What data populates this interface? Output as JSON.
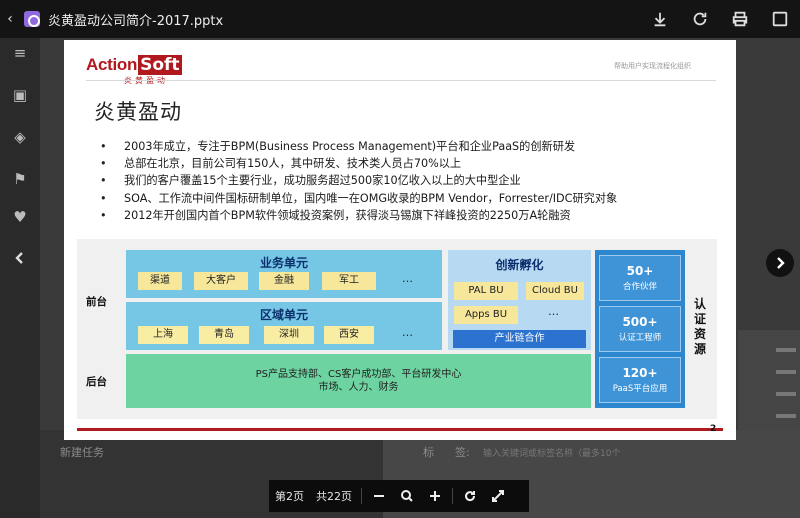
{
  "window": {
    "title": "炎黄盈动公司简介-2017.pptx",
    "back_icon": "back-icon",
    "file_icon": "pptx-file-icon",
    "actions": [
      "download-icon",
      "refresh-icon",
      "print-icon",
      "fullscreen-icon"
    ]
  },
  "background": {
    "new_task": "新建任务",
    "tag_label": "标",
    "tag_label2": "签:",
    "tag_placeholder": "输入关键词或标签名称（最多10个"
  },
  "slide": {
    "logo_action": "Action",
    "logo_soft": "Soft",
    "logo_sub": "炎黄盈动",
    "tagline": "帮助用户实现流程化组织",
    "title": "炎黄盈动",
    "bullets": [
      "2003年成立，专注于BPM(Business Process Management)平台和企业PaaS的创新研发",
      "总部在北京，目前公司有150人，其中研发、技术类人员占70%以上",
      "我们的客户覆盖15个主要行业，成功服务超过500家10亿收入以上的大中型企业",
      "SOA、工作流中间件国标研制单位，国内唯一在OMG收录的BPM Vendor，Forrester/IDC研究对象",
      "2012年开创国内首个BPM软件领域投资案例，获得淡马锡旗下祥峰投资的2250万A轮融资"
    ],
    "page_number": "2",
    "diagram": {
      "front_label": "前台",
      "back_label": "后台",
      "business_unit": {
        "title": "业务单元",
        "items": [
          "渠道",
          "大客户",
          "金融",
          "军工"
        ],
        "more": "…"
      },
      "region_unit": {
        "title": "区域单元",
        "items": [
          "上海",
          "青岛",
          "深圳",
          "西安"
        ],
        "more": "…"
      },
      "incubation": {
        "title": "创新孵化",
        "items": [
          "PAL BU",
          "Cloud BU",
          "Apps BU"
        ],
        "more": "…",
        "chain": "产业链合作"
      },
      "platform": {
        "line1": "PS产品支持部、CS客户成功部、平台研发中心",
        "line2": "市场、人力、财务"
      },
      "certification": {
        "title": "认证资源",
        "items": [
          {
            "num": "50+",
            "text": "合作伙伴"
          },
          {
            "num": "500+",
            "text": "认证工程师"
          },
          {
            "num": "120+",
            "text": "PaaS平台应用"
          }
        ]
      }
    }
  },
  "pager": {
    "current": "第2页",
    "total": "共22页"
  }
}
